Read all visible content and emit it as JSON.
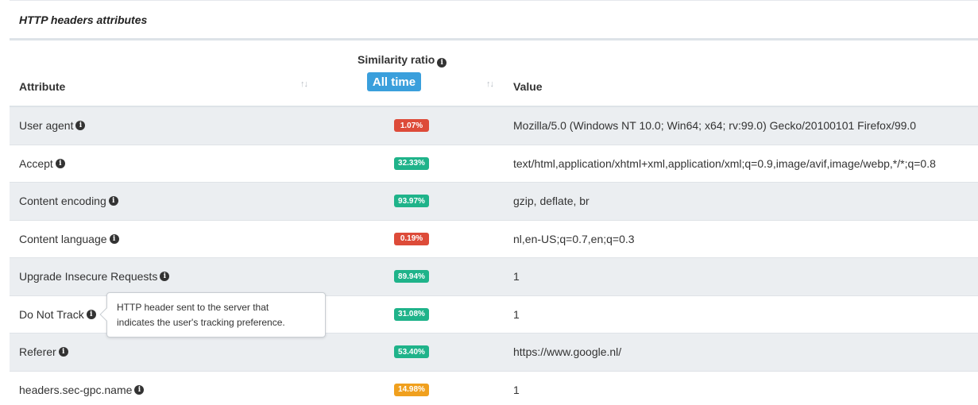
{
  "panel": {
    "title": "HTTP headers attributes"
  },
  "table": {
    "header": {
      "attribute": "Attribute",
      "similarity": "Similarity ratio",
      "filter": "All time",
      "value": "Value",
      "sort_glyph": "↑↓"
    },
    "rows": [
      {
        "attribute": "User agent",
        "ratio": "1.07%",
        "status": "low",
        "value": "Mozilla/5.0 (Windows NT 10.0; Win64; x64; rv:99.0) Gecko/20100101 Firefox/99.0"
      },
      {
        "attribute": "Accept",
        "ratio": "32.33%",
        "status": "high",
        "value": "text/html,application/xhtml+xml,application/xml;q=0.9,image/avif,image/webp,*/*;q=0.8"
      },
      {
        "attribute": "Content encoding",
        "ratio": "93.97%",
        "status": "high",
        "value": "gzip, deflate, br"
      },
      {
        "attribute": "Content language",
        "ratio": "0.19%",
        "status": "low",
        "value": "nl,en-US;q=0.7,en;q=0.3"
      },
      {
        "attribute": "Upgrade Insecure Requests",
        "ratio": "89.94%",
        "status": "high",
        "value": "1"
      },
      {
        "attribute": "Do Not Track",
        "ratio": "31.08%",
        "status": "high",
        "value": "1"
      },
      {
        "attribute": "Referer",
        "ratio": "53.40%",
        "status": "high",
        "value": "https://www.google.nl/"
      },
      {
        "attribute": "headers.sec-gpc.name",
        "ratio": "14.98%",
        "status": "medium",
        "value": "1"
      }
    ]
  },
  "tooltip": {
    "line1": "HTTP header sent to the server that",
    "line2": "indicates the user's tracking preference."
  },
  "icons": {
    "info": "info-circle-icon",
    "sort": "sort-icon"
  },
  "colors": {
    "low": "#dd4b39",
    "high": "#1fb38a",
    "medium": "#f0a01e",
    "accent": "#3a9fdc"
  }
}
